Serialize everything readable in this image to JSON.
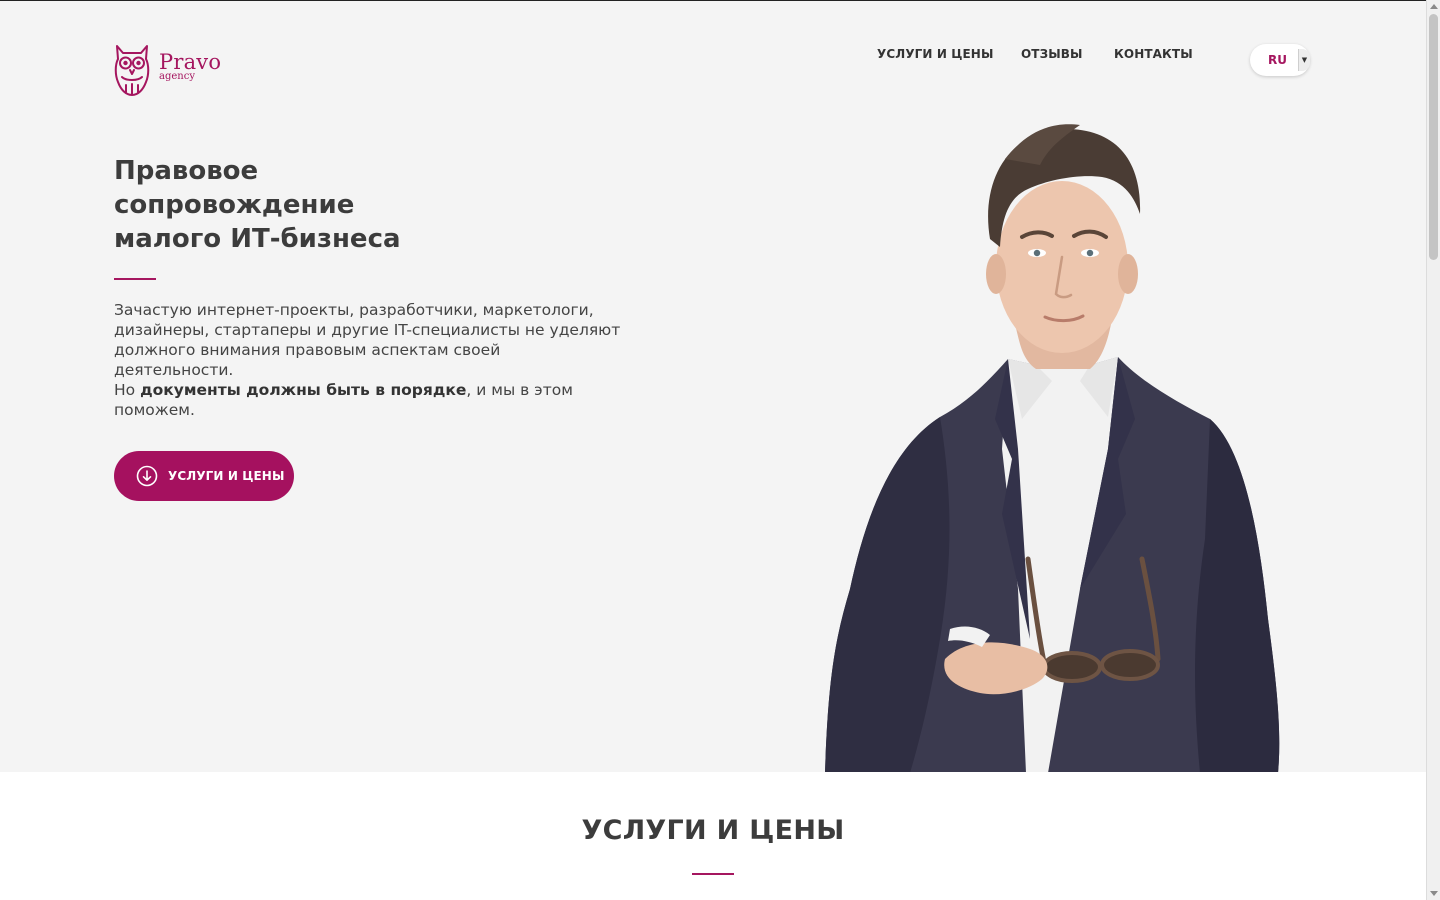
{
  "brand": {
    "name": "Pravo",
    "sub": "agency",
    "color": "#a5165f"
  },
  "nav": {
    "items": [
      {
        "label": "УСЛУГИ И ЦЕНЫ"
      },
      {
        "label": "ОТЗЫВЫ"
      },
      {
        "label": "КОНТАКТЫ"
      }
    ]
  },
  "language": {
    "selected": "RU"
  },
  "hero": {
    "title_lines": [
      "Правовое",
      "сопровождение",
      "малого ИТ-бизнеса"
    ],
    "description": "Зачастую интернет-проекты, разработчики, маркетологи, дизайнеры, стартаперы и другие IT-специалисты не уделяют должного внимания правовым аспектам своей деятельности.",
    "note_prefix": "Но ",
    "note_bold": "документы должны быть в порядке",
    "note_suffix": ", и мы в этом поможем.",
    "cta_label": "УСЛУГИ И ЦЕНЫ",
    "cta_icon": "arrow-down-circle-icon",
    "image_icon": "man-in-suit-portrait"
  },
  "services": {
    "title": "УСЛУГИ И ЦЕНЫ"
  },
  "colors": {
    "accent": "#a5165f",
    "hero_bg": "#f4f4f4",
    "button": "#a5115f"
  }
}
